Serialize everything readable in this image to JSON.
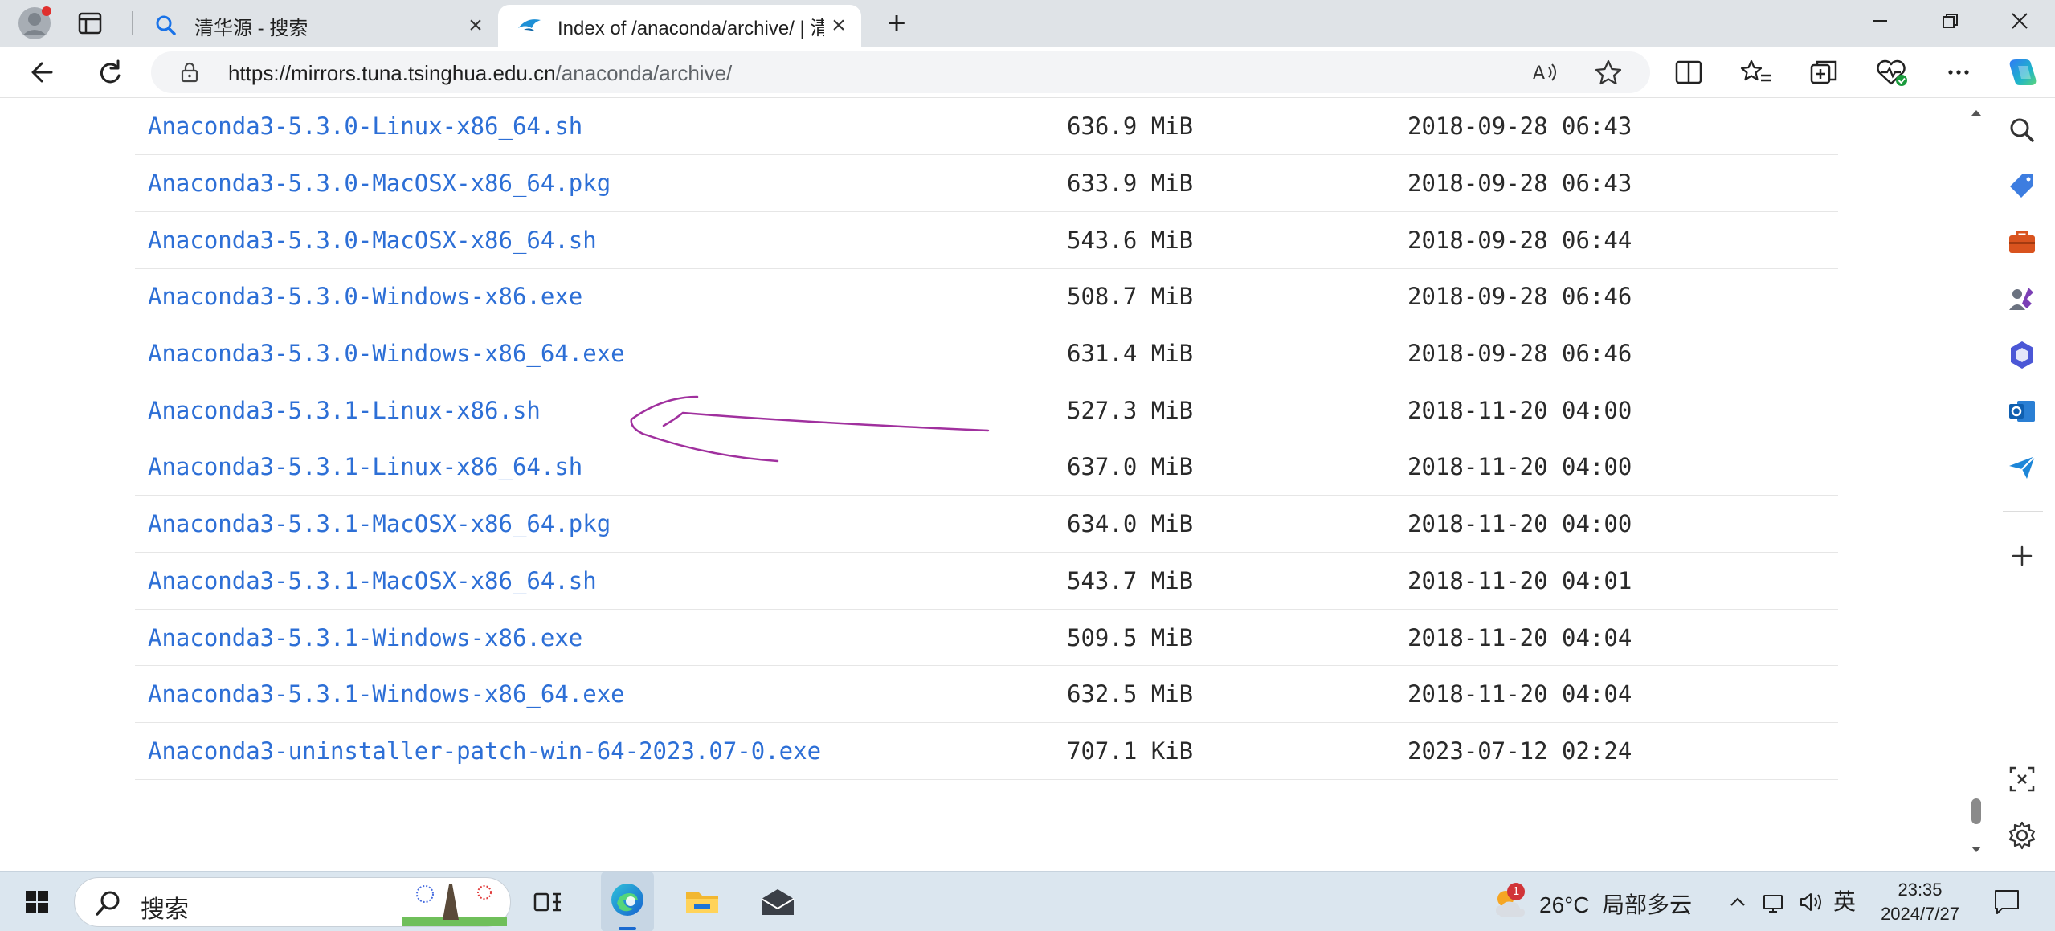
{
  "browser": {
    "tabs": [
      {
        "title": "清华源 - 搜索",
        "icon": "search-icon",
        "active": false
      },
      {
        "title": "Index of /anaconda/archive/ | 清",
        "icon": "tuna-logo-icon",
        "active": true
      }
    ],
    "address": {
      "host": "https://mirrors.tuna.tsinghua.edu.cn",
      "path": "/anaconda/archive/"
    }
  },
  "files": [
    {
      "name": "Anaconda3-5.3.0-Linux-x86_64.sh",
      "size": "636.9 MiB",
      "date": "2018-09-28 06:43"
    },
    {
      "name": "Anaconda3-5.3.0-MacOSX-x86_64.pkg",
      "size": "633.9 MiB",
      "date": "2018-09-28 06:43"
    },
    {
      "name": "Anaconda3-5.3.0-MacOSX-x86_64.sh",
      "size": "543.6 MiB",
      "date": "2018-09-28 06:44"
    },
    {
      "name": "Anaconda3-5.3.0-Windows-x86.exe",
      "size": "508.7 MiB",
      "date": "2018-09-28 06:46"
    },
    {
      "name": "Anaconda3-5.3.0-Windows-x86_64.exe",
      "size": "631.4 MiB",
      "date": "2018-09-28 06:46"
    },
    {
      "name": "Anaconda3-5.3.1-Linux-x86.sh",
      "size": "527.3 MiB",
      "date": "2018-11-20 04:00"
    },
    {
      "name": "Anaconda3-5.3.1-Linux-x86_64.sh",
      "size": "637.0 MiB",
      "date": "2018-11-20 04:00"
    },
    {
      "name": "Anaconda3-5.3.1-MacOSX-x86_64.pkg",
      "size": "634.0 MiB",
      "date": "2018-11-20 04:00"
    },
    {
      "name": "Anaconda3-5.3.1-MacOSX-x86_64.sh",
      "size": "543.7 MiB",
      "date": "2018-11-20 04:01"
    },
    {
      "name": "Anaconda3-5.3.1-Windows-x86.exe",
      "size": "509.5 MiB",
      "date": "2018-11-20 04:04"
    },
    {
      "name": "Anaconda3-5.3.1-Windows-x86_64.exe",
      "size": "632.5 MiB",
      "date": "2018-11-20 04:04"
    },
    {
      "name": "Anaconda3-uninstaller-patch-win-64-2023.07-0.exe",
      "size": "707.1 KiB",
      "date": "2023-07-12 02:24"
    }
  ],
  "taskbar": {
    "search_placeholder": "搜索",
    "weather": {
      "temp": "26°C",
      "desc": "局部多云",
      "alerts": "1"
    },
    "ime": "英",
    "time": "23:35",
    "date": "2024/7/27"
  },
  "colors": {
    "link": "#2d6fd6",
    "annotation": "#a0309e",
    "taskbar": "#dbe6ef"
  }
}
